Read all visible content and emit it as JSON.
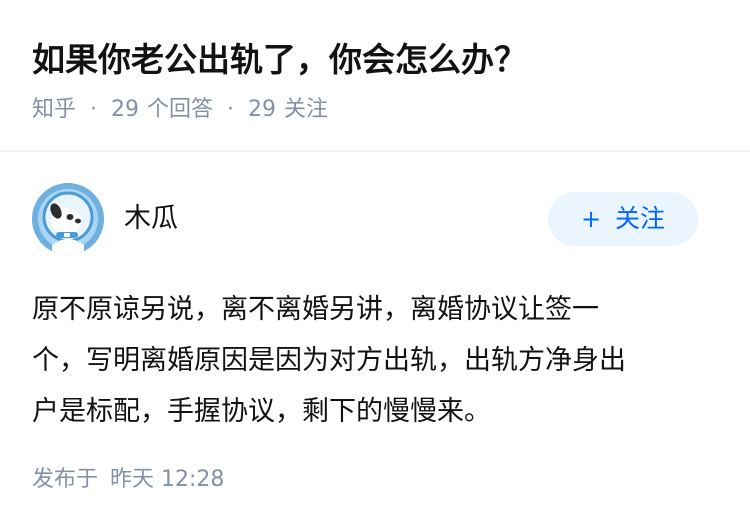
{
  "question": {
    "title": "如果你老公出轨了，你会怎么办？",
    "source": "知乎",
    "answers_count": "29",
    "answers_label": "个回答",
    "followers_count": "29",
    "followers_label": "关注"
  },
  "author": {
    "name": "木瓜",
    "avatar_icon": "cartoon-dog-avatar",
    "follow_label": "关注"
  },
  "answer": {
    "lines": [
      "原不原谅另说，离不离婚另讲，离婚协议让签一",
      "个，写明离婚原因是因为对方出轨，出轨方净身出",
      "户是标配，手握协议，剩下的慢慢来。"
    ],
    "published_label": "发布于",
    "published_time": "昨天 12:28"
  },
  "colors": {
    "text": "#121212",
    "meta": "#8590a6",
    "brand": "#0066ff",
    "follow_bg": "#ebf5ff"
  }
}
